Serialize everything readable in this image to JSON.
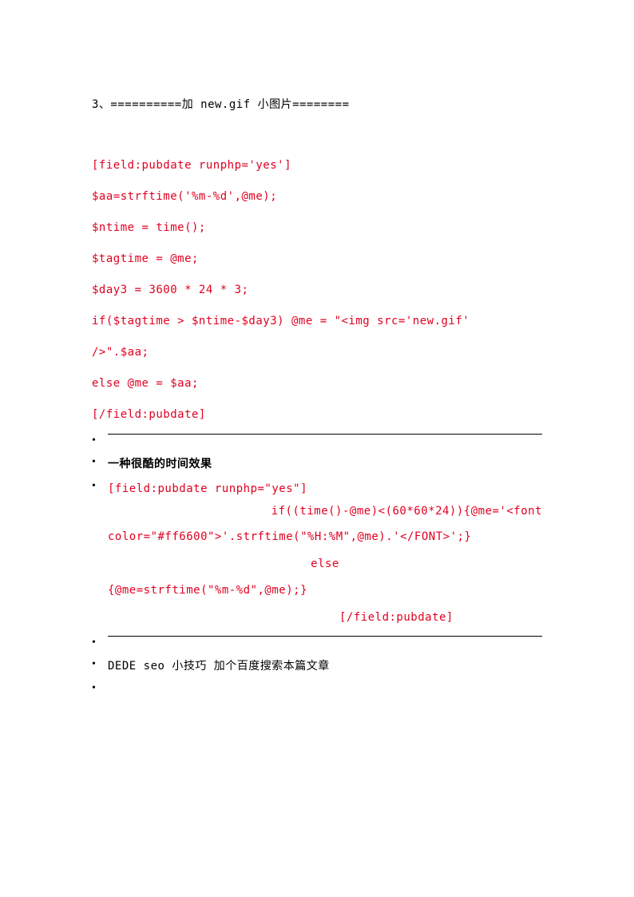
{
  "heading": "3、==========加 new.gif 小图片========",
  "code1": {
    "l1": "[field:pubdate runphp='yes']",
    "l2": "$aa=strftime('%m-%d',@me);",
    "l3": "$ntime = time();",
    "l4": "$tagtime = @me;",
    "l5": "$day3 = 3600 * 24 * 3;",
    "l6": "if($tagtime > $ntime-$day3) @me = \"<img src='new.gif'",
    "l7": "/>\".$aa;",
    "l8": "else @me = $aa;",
    "l9": "[/field:pubdate]"
  },
  "item_cool": "一种很酷的时间效果",
  "code2": {
    "l1": "[field:pubdate runphp=\"yes\"]",
    "l2": "if((time()-@me)<(60*60*24)){@me='<font",
    "l3": "color=\"#ff6600\">'.strftime(\"%H:%M\",@me).'</FONT>';}",
    "l4": "else",
    "l5": "{@me=strftime(\"%m-%d\",@me);}",
    "l6": "[/field:pubdate]"
  },
  "item_seo": "DEDE seo 小技巧 加个百度搜索本篇文章"
}
